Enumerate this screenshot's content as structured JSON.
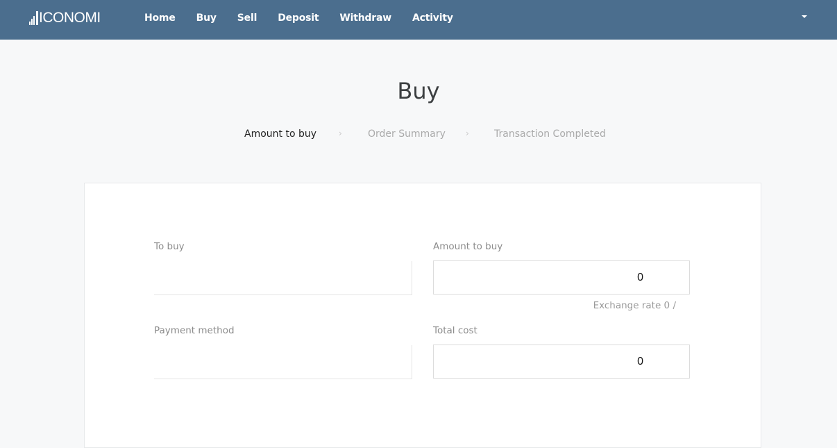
{
  "brand": {
    "name": "ICONOMI"
  },
  "nav": {
    "items": [
      {
        "label": "Home"
      },
      {
        "label": "Buy"
      },
      {
        "label": "Sell"
      },
      {
        "label": "Deposit"
      },
      {
        "label": "Withdraw"
      },
      {
        "label": "Activity"
      }
    ],
    "user_menu_icon": "caret-down-icon"
  },
  "page": {
    "title": "Buy"
  },
  "steps": {
    "items": [
      {
        "label": "Amount to buy",
        "state": "active"
      },
      {
        "label": "Order Summary",
        "state": "inactive"
      },
      {
        "label": "Transaction Completed",
        "state": "inactive"
      }
    ],
    "separator_icon": "chevron-right-icon"
  },
  "form": {
    "to_buy": {
      "label": "To buy",
      "value": ""
    },
    "amount_to_buy": {
      "label": "Amount to buy",
      "value": "0"
    },
    "exchange_rate": "Exchange rate 0 /",
    "payment_method": {
      "label": "Payment method",
      "value": ""
    },
    "total_cost": {
      "label": "Total cost",
      "value": "0"
    }
  },
  "colors": {
    "navbar": "#4b6e8e",
    "background": "#f7f8f9",
    "card": "#ffffff",
    "text_active": "#222222",
    "text_muted": "#aaaaaa"
  }
}
